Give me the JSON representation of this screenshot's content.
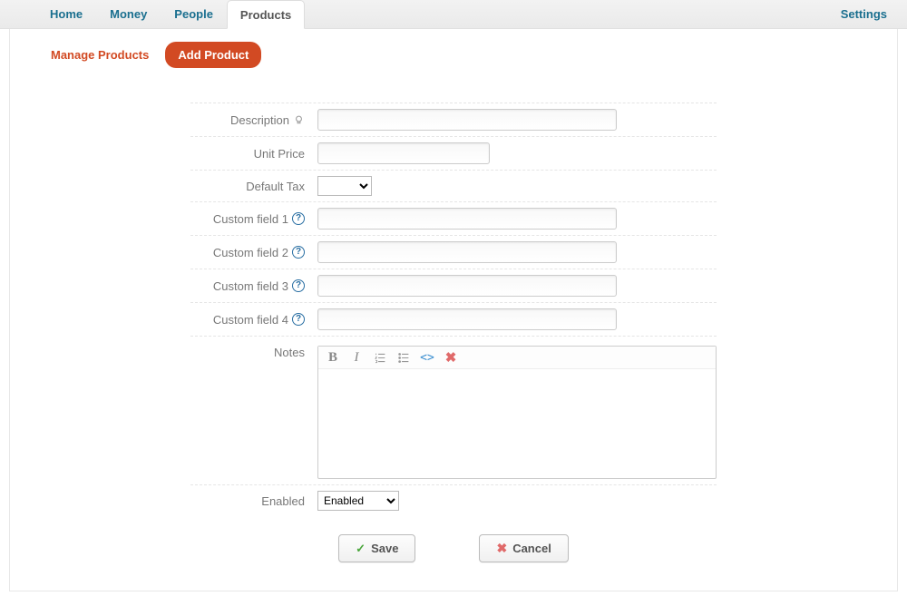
{
  "nav": {
    "home": "Home",
    "money": "Money",
    "people": "People",
    "products": "Products",
    "settings": "Settings"
  },
  "subnav": {
    "manage": "Manage Products",
    "add": "Add Product"
  },
  "form": {
    "description": {
      "label": "Description",
      "value": ""
    },
    "unit_price": {
      "label": "Unit Price",
      "value": ""
    },
    "default_tax": {
      "label": "Default Tax",
      "selected": "",
      "options": [
        ""
      ]
    },
    "custom1": {
      "label": "Custom field 1",
      "value": ""
    },
    "custom2": {
      "label": "Custom field 2",
      "value": ""
    },
    "custom3": {
      "label": "Custom field 3",
      "value": ""
    },
    "custom4": {
      "label": "Custom field 4",
      "value": ""
    },
    "notes": {
      "label": "Notes",
      "value": ""
    },
    "enabled": {
      "label": "Enabled",
      "selected": "Enabled",
      "options": [
        "Enabled"
      ]
    }
  },
  "editor_toolbar": {
    "bold": "B",
    "italic": "I",
    "code": "<>",
    "clear": "✖"
  },
  "actions": {
    "save": "Save",
    "cancel": "Cancel"
  }
}
